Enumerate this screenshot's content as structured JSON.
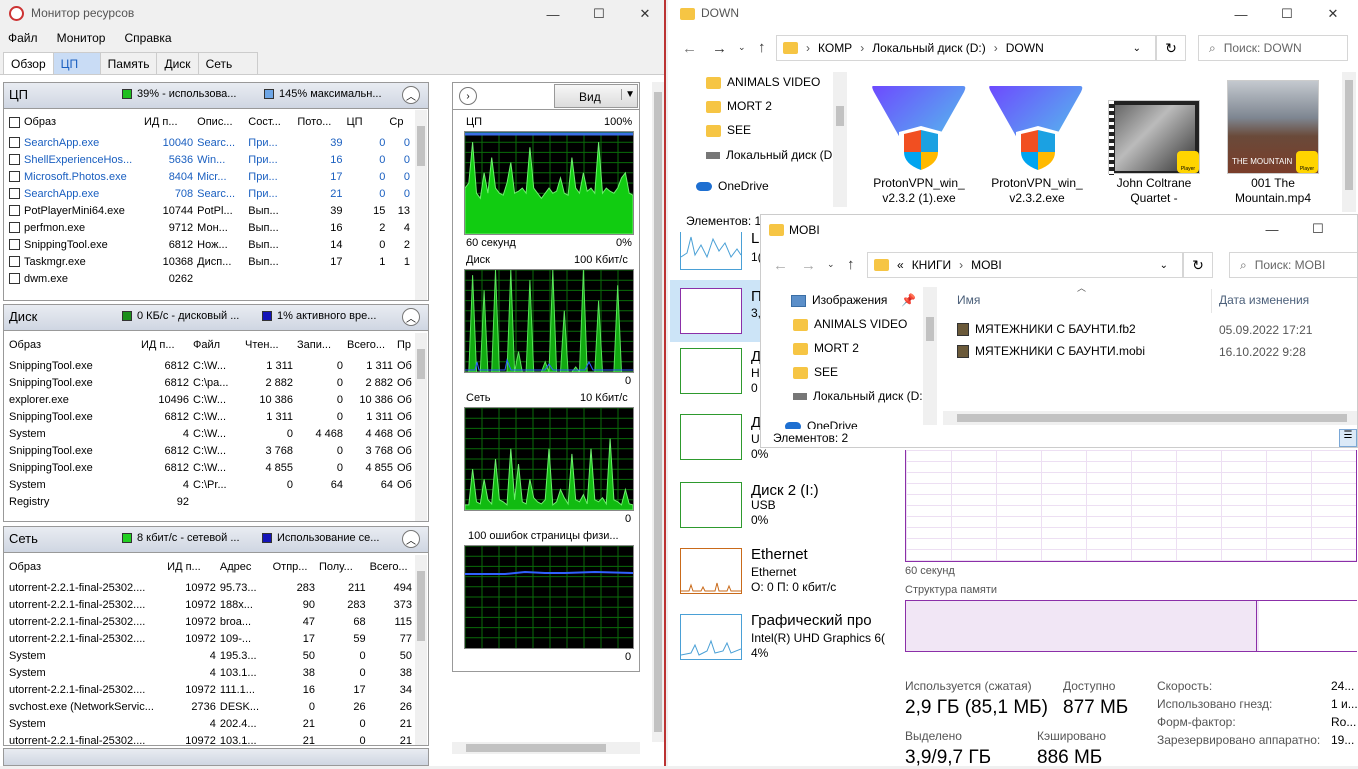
{
  "resmon": {
    "title": "Монитор ресурсов",
    "menu": [
      "Файл",
      "Монитор",
      "Справка"
    ],
    "tabs": [
      "Обзор",
      "ЦП",
      "Память",
      "Диск",
      "Сеть"
    ],
    "cpu": {
      "title": "ЦП",
      "legend1": "39% - использова...",
      "legend2": "145% максимальн...",
      "headers": [
        "Образ",
        "ИД п...",
        "Опис...",
        "Сост...",
        "Пото...",
        "ЦП",
        "Ср"
      ],
      "rows": [
        [
          "SearchApp.exe",
          "10040",
          "Searc...",
          "При...",
          "39",
          "0",
          "0"
        ],
        [
          "ShellExperienceHos...",
          "5636",
          "Win...",
          "При...",
          "16",
          "0",
          "0"
        ],
        [
          "Microsoft.Photos.exe",
          "8404",
          "Micr...",
          "При...",
          "17",
          "0",
          "0"
        ],
        [
          "SearchApp.exe",
          "708",
          "Searc...",
          "При...",
          "21",
          "0",
          "0"
        ],
        [
          "PotPlayerMini64.exe",
          "10744",
          "PotPl...",
          "Вып...",
          "39",
          "15",
          "13"
        ],
        [
          "perfmon.exe",
          "9712",
          "Мон...",
          "Вып...",
          "16",
          "2",
          "4"
        ],
        [
          "SnippingTool.exe",
          "6812",
          "Нож...",
          "Вып...",
          "14",
          "0",
          "2"
        ],
        [
          "Taskmgr.exe",
          "10368",
          "Дисп...",
          "Вып...",
          "17",
          "1",
          "1"
        ],
        [
          "dwm.exe",
          "0262",
          "",
          "",
          "",
          "",
          ""
        ]
      ]
    },
    "disk": {
      "title": "Диск",
      "legend1": "0 КБ/с - дисковый ...",
      "legend2": "1% активного вре...",
      "headers": [
        "Образ",
        "ИД п...",
        "Файл",
        "Чтен...",
        "Запи...",
        "Всего...",
        "Пр"
      ],
      "rows": [
        [
          "SnippingTool.exe",
          "6812",
          "C:\\W...",
          "1 311",
          "0",
          "1 311",
          "Об"
        ],
        [
          "SnippingTool.exe",
          "6812",
          "C:\\pa...",
          "2 882",
          "0",
          "2 882",
          "Об"
        ],
        [
          "explorer.exe",
          "10496",
          "C:\\W...",
          "10 386",
          "0",
          "10 386",
          "Об"
        ],
        [
          "SnippingTool.exe",
          "6812",
          "C:\\W...",
          "1 311",
          "0",
          "1 311",
          "Об"
        ],
        [
          "System",
          "4",
          "C:\\W...",
          "0",
          "4 468",
          "4 468",
          "Об"
        ],
        [
          "SnippingTool.exe",
          "6812",
          "C:\\W...",
          "3 768",
          "0",
          "3 768",
          "Об"
        ],
        [
          "SnippingTool.exe",
          "6812",
          "C:\\W...",
          "4 855",
          "0",
          "4 855",
          "Об"
        ],
        [
          "System",
          "4",
          "C:\\Pr...",
          "0",
          "64",
          "64",
          "Об"
        ],
        [
          "Registry",
          "92",
          "",
          "",
          "",
          "",
          ""
        ]
      ]
    },
    "net": {
      "title": "Сеть",
      "legend1": "8 кбит/с - сетевой ...",
      "legend2": "Использование се...",
      "headers": [
        "Образ",
        "ИД п...",
        "Адрес",
        "Отпр...",
        "Полу...",
        "Всего..."
      ],
      "rows": [
        [
          "utorrent-2.2.1-final-25302....",
          "10972",
          "95.73...",
          "283",
          "211",
          "494"
        ],
        [
          "utorrent-2.2.1-final-25302....",
          "10972",
          "188х...",
          "90",
          "283",
          "373"
        ],
        [
          "utorrent-2.2.1-final-25302....",
          "10972",
          "broa...",
          "47",
          "68",
          "115"
        ],
        [
          "utorrent-2.2.1-final-25302....",
          "10972",
          "109-...",
          "17",
          "59",
          "77"
        ],
        [
          "System",
          "4",
          "195.3...",
          "50",
          "0",
          "50"
        ],
        [
          "System",
          "4",
          "103.1...",
          "38",
          "0",
          "38"
        ],
        [
          "utorrent-2.2.1-final-25302....",
          "10972",
          "111.1...",
          "16",
          "17",
          "34"
        ],
        [
          "svchost.exe (NetworkServic...",
          "2736",
          "DESK...",
          "0",
          "26",
          "26"
        ],
        [
          "System",
          "4",
          "202.4...",
          "21",
          "0",
          "21"
        ],
        [
          "utorrent-2.2.1-final-25302....",
          "10972",
          "103.1...",
          "21",
          "0",
          "21"
        ]
      ]
    },
    "graphs": {
      "view_label": "Вид",
      "cpu_label": "ЦП",
      "cpu_max": "100%",
      "cpu_time": "60 секунд",
      "cpu_min": "0%",
      "disk_label": "Диск",
      "disk_max": "100 Кбит/с",
      "disk_min": "0",
      "net_label": "Сеть",
      "net_max": "10 Кбит/с",
      "net_min": "0",
      "mem_label": "100 ошибок страницы физи...",
      "mem_min": "0"
    }
  },
  "explorer1": {
    "title": "DOWN",
    "path": [
      "КОМР",
      "Локальный диск (D:)",
      "DOWN"
    ],
    "search": "Поиск: DOWN",
    "nav": [
      "ANIMALS VIDEO",
      "MORT 2",
      "SEE",
      "Локальный диск (D:",
      "OneDrive"
    ],
    "items": [
      "ProtonVPN_win_ v2.3.2 (1).exe",
      "ProtonVPN_win_ v2.3.2.exe",
      "John Coltrane Quartet -",
      "001 The Mountain.mp4"
    ],
    "status": "Элементов: 1",
    "thumb_text": "THE MOUNTAIN",
    "badge": "Player"
  },
  "explorer2": {
    "title": "MOBI",
    "path_prefix": "«",
    "path": [
      "КНИГИ",
      "MOBI"
    ],
    "search": "Поиск: MOBI",
    "nav": [
      "Изображения",
      "ANIMALS VIDEO",
      "MORT 2",
      "SEE",
      "Локальный диск (D:",
      "OneDrive"
    ],
    "col_name": "Имя",
    "col_date": "Дата изменения",
    "files": [
      {
        "name": "МЯТЕЖНИКИ С БАУНТИ.fb2",
        "date": "05.09.2022 17:21"
      },
      {
        "name": "МЯТЕЖНИКИ С БАУНТИ.mobi",
        "date": "16.10.2022 9:28"
      }
    ],
    "status": "Элементов: 2"
  },
  "taskmgr": {
    "items": [
      {
        "name": "Д",
        "sub1": "U",
        "sub2": "0%"
      },
      {
        "name": "Диск 2 (I:)",
        "sub1": "USB",
        "sub2": "0%"
      },
      {
        "name": "Ethernet",
        "sub1": "Ethernet",
        "sub2": "О: 0 П: 0 кбит/с"
      },
      {
        "name": "Графический про",
        "sub1": "Intel(R) UHD Graphics 6(",
        "sub2": "4%"
      }
    ],
    "partial": {
      "a": "L",
      "b": "1(",
      "c": "П",
      "d": "3,",
      "e": "Д",
      "f": "Н",
      "g": "0"
    },
    "time_label": "60 секунд",
    "struct_label": "Структура памяти",
    "stats": {
      "used_label": "Используется (сжатая)",
      "used_val": "2,9 ГБ (85,1 МБ)",
      "avail_label": "Доступно",
      "avail_val": "877 МБ",
      "commit_label": "Выделено",
      "commit_val": "3,9/9,7 ГБ",
      "cached_label": "Кэшировано",
      "cached_val": "886 МБ"
    },
    "right": [
      {
        "label": "Скорость:",
        "val": "24..."
      },
      {
        "label": "Использовано гнезд:",
        "val": "1 и..."
      },
      {
        "label": "Форм-фактор:",
        "val": "Ro..."
      },
      {
        "label": "Зарезервировано аппаратно:",
        "val": "19..."
      }
    ]
  }
}
